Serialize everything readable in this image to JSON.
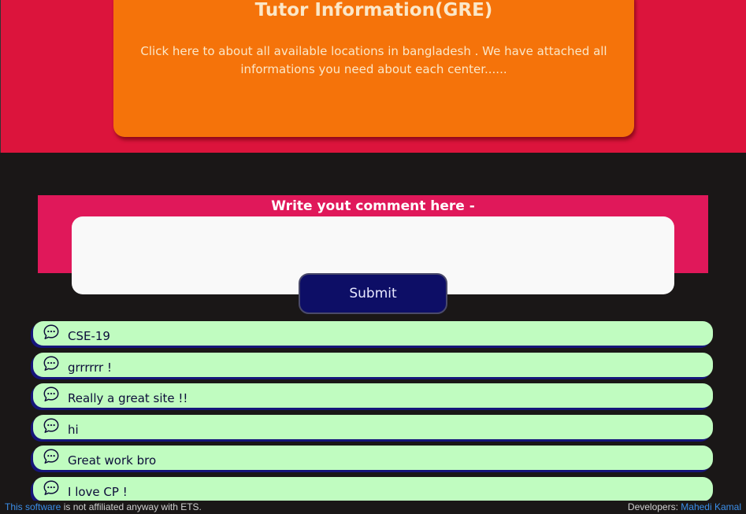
{
  "hero": {
    "title": "Tutor Information(GRE)",
    "description": "Click here to about all available locations in bangladesh . We have attached all informations you need about each center......"
  },
  "comment_form": {
    "label": "Write yout comment here -",
    "input_value": "",
    "submit_label": "Submit"
  },
  "comments": [
    {
      "text": "CSE-19",
      "icon": "speech-bubble-icon"
    },
    {
      "text": "grrrrrr !",
      "icon": "speech-bubble-icon"
    },
    {
      "text": "Really a great site !!",
      "icon": "speech-bubble-icon"
    },
    {
      "text": "hi",
      "icon": "speech-bubble-icon"
    },
    {
      "text": "Great work bro",
      "icon": "speech-bubble-icon"
    },
    {
      "text": "I love CP !",
      "icon": "speech-bubble-icon"
    }
  ],
  "footer": {
    "software_link": "This software",
    "disclaimer": " is not affiliated anyway with ETS.",
    "developers_label": "Developers: ",
    "developer_name": "Mahedi Kamal"
  },
  "colors": {
    "hero_bg": "#dc143c",
    "card_bg": "#f5730a",
    "comment_band": "#e0185a",
    "submit_bg": "#0d0e66",
    "comment_bg": "#c0fcc0",
    "page_bg": "#1a1717",
    "link": "#3b8ee8"
  }
}
